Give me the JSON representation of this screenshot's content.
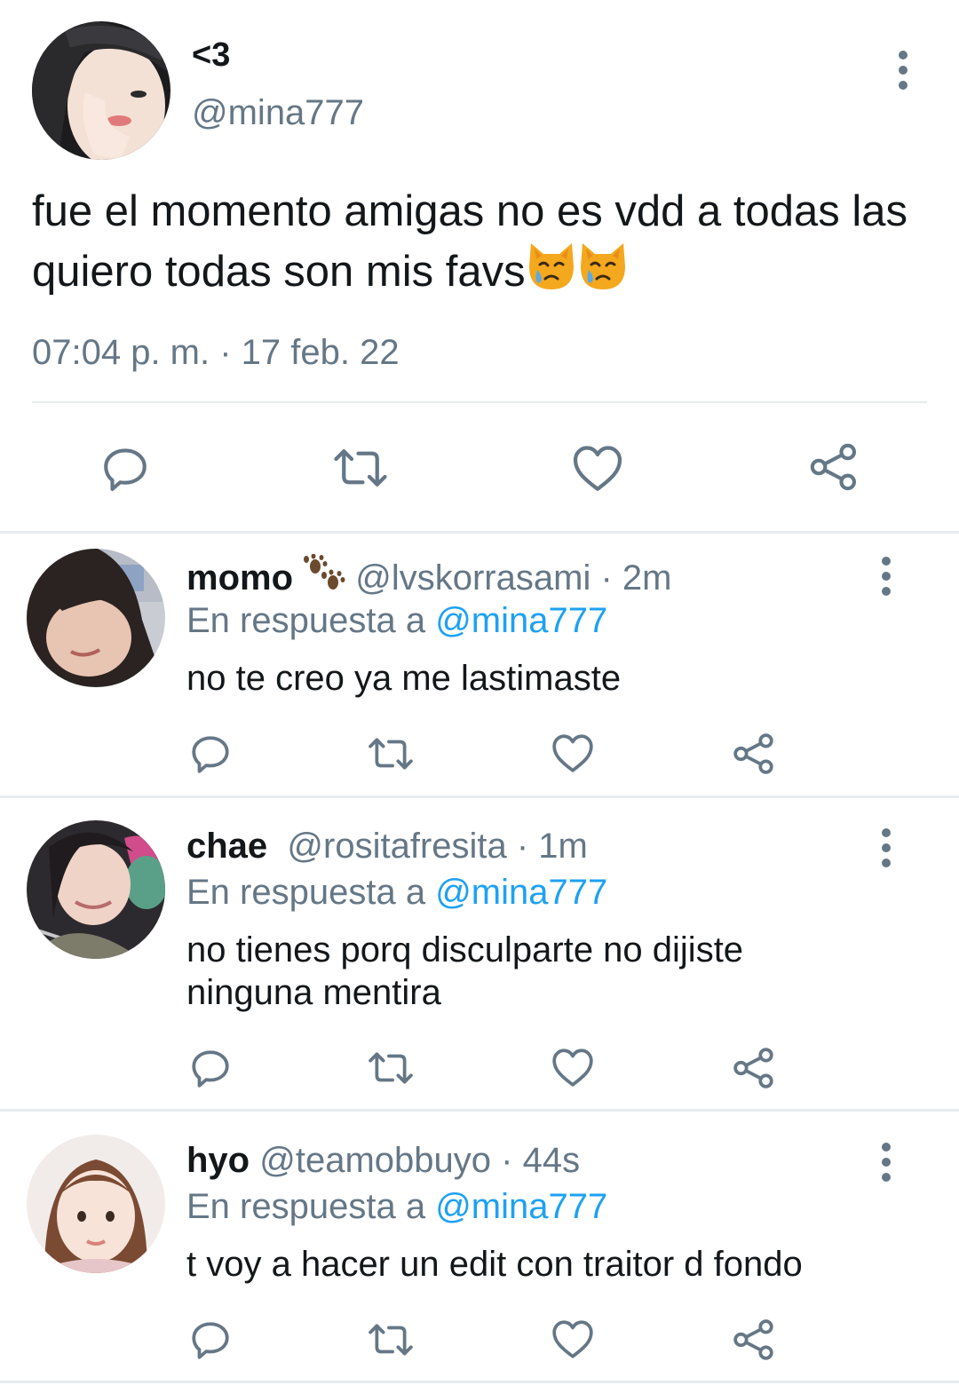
{
  "main_tweet": {
    "display_name": "<3",
    "handle": "@mina777",
    "text": "fue el momento amigas no es vdd a todas las quiero todas son mis favs",
    "emojis": [
      "crying-cat-face",
      "crying-cat-face"
    ],
    "timestamp": "07:04 p. m. · 17 feb. 22",
    "actions": [
      "reply",
      "retweet",
      "like",
      "share"
    ]
  },
  "replies": [
    {
      "display_name": "momo",
      "badge_emoji": "paw-prints",
      "handle": "@lvskorrasami",
      "time": "· 2m",
      "reply_prefix": "En respuesta a",
      "reply_to": "@mina777",
      "text_lines": [
        "no te creo ya me lastimaste"
      ]
    },
    {
      "display_name": "chae",
      "handle": "@rositafresita",
      "time": "· 1m",
      "reply_prefix": "En respuesta a",
      "reply_to": "@mina777",
      "text_lines": [
        "no tienes porq disculparte no dijiste",
        "ninguna mentira"
      ]
    },
    {
      "display_name": "hyo",
      "handle": "@teamobbuyo",
      "time": "· 44s",
      "reply_prefix": "En respuesta a",
      "reply_to": "@mina777",
      "text_lines": [
        "t voy a hacer un edit con traitor d fondo"
      ]
    }
  ],
  "colors": {
    "link": "#1da1f2",
    "secondary_text": "#657786",
    "divider": "#e6ecf0",
    "icon": "#657786"
  }
}
